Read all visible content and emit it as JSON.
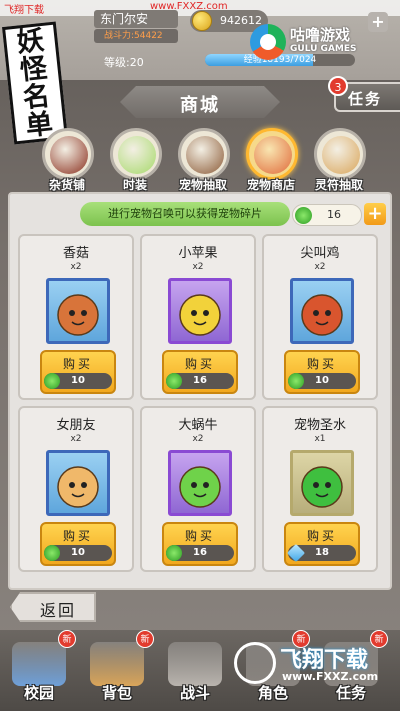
{
  "watermark_top": {
    "left": "飞翔下载",
    "url": "www.FXXZ.com"
  },
  "player": {
    "name": "东门尔安",
    "power": "战斗力:54422",
    "coins": "942612",
    "plus": "+",
    "level": "等级:20",
    "exp_text": "经验18193/7024",
    "exp_fraction": 0.72
  },
  "logo": {
    "text": "妖怪名单"
  },
  "gulu": {
    "cn": "咕噜游戏",
    "en": "GULU GAMES"
  },
  "title": "商城",
  "task": {
    "label": "任务",
    "badge": "3"
  },
  "tabs": [
    {
      "label": "杂货铺",
      "active": false,
      "color": "#8a2f1e"
    },
    {
      "label": "时装",
      "active": false,
      "color": "#a6d96a"
    },
    {
      "label": "宠物抽取",
      "active": false,
      "color": "#8b5a36"
    },
    {
      "label": "宠物商店",
      "active": true,
      "color": "#e06a3a"
    },
    {
      "label": "灵符抽取",
      "active": false,
      "color": "#d9a55a"
    }
  ],
  "shop": {
    "info": "进行宠物召唤可以获得宠物碎片",
    "shards": "16",
    "shard_plus": "+",
    "items": [
      {
        "name": "香菇",
        "qty": "x2",
        "buy": "购买",
        "price": "10",
        "frame": "blue",
        "currency": "shard",
        "art": "#d8743a"
      },
      {
        "name": "小苹果",
        "qty": "x2",
        "buy": "购买",
        "price": "16",
        "frame": "purple",
        "currency": "shard",
        "art": "#f2d23a"
      },
      {
        "name": "尖叫鸡",
        "qty": "x2",
        "buy": "购买",
        "price": "10",
        "frame": "blue",
        "currency": "shard",
        "art": "#d9552e"
      },
      {
        "name": "女朋友",
        "qty": "x2",
        "buy": "购买",
        "price": "10",
        "frame": "blue",
        "currency": "shard",
        "art": "#f0b86a"
      },
      {
        "name": "大蜗牛",
        "qty": "x2",
        "buy": "购买",
        "price": "16",
        "frame": "purple",
        "currency": "shard",
        "art": "#6fd24a"
      },
      {
        "name": "宠物圣水",
        "qty": "x1",
        "buy": "购买",
        "price": "18",
        "frame": "green",
        "currency": "diamond",
        "art": "#3fbf3f"
      }
    ]
  },
  "back": "返回",
  "nav": [
    {
      "label": "校园",
      "new": "新"
    },
    {
      "label": "背包",
      "new": "新"
    },
    {
      "label": "战斗",
      "new": ""
    },
    {
      "label": "角色",
      "new": "新"
    },
    {
      "label": "任务",
      "new": "新"
    }
  ],
  "watermark_bottom": {
    "cn": "飞翔下载",
    "url": "www.FXXZ.com"
  }
}
